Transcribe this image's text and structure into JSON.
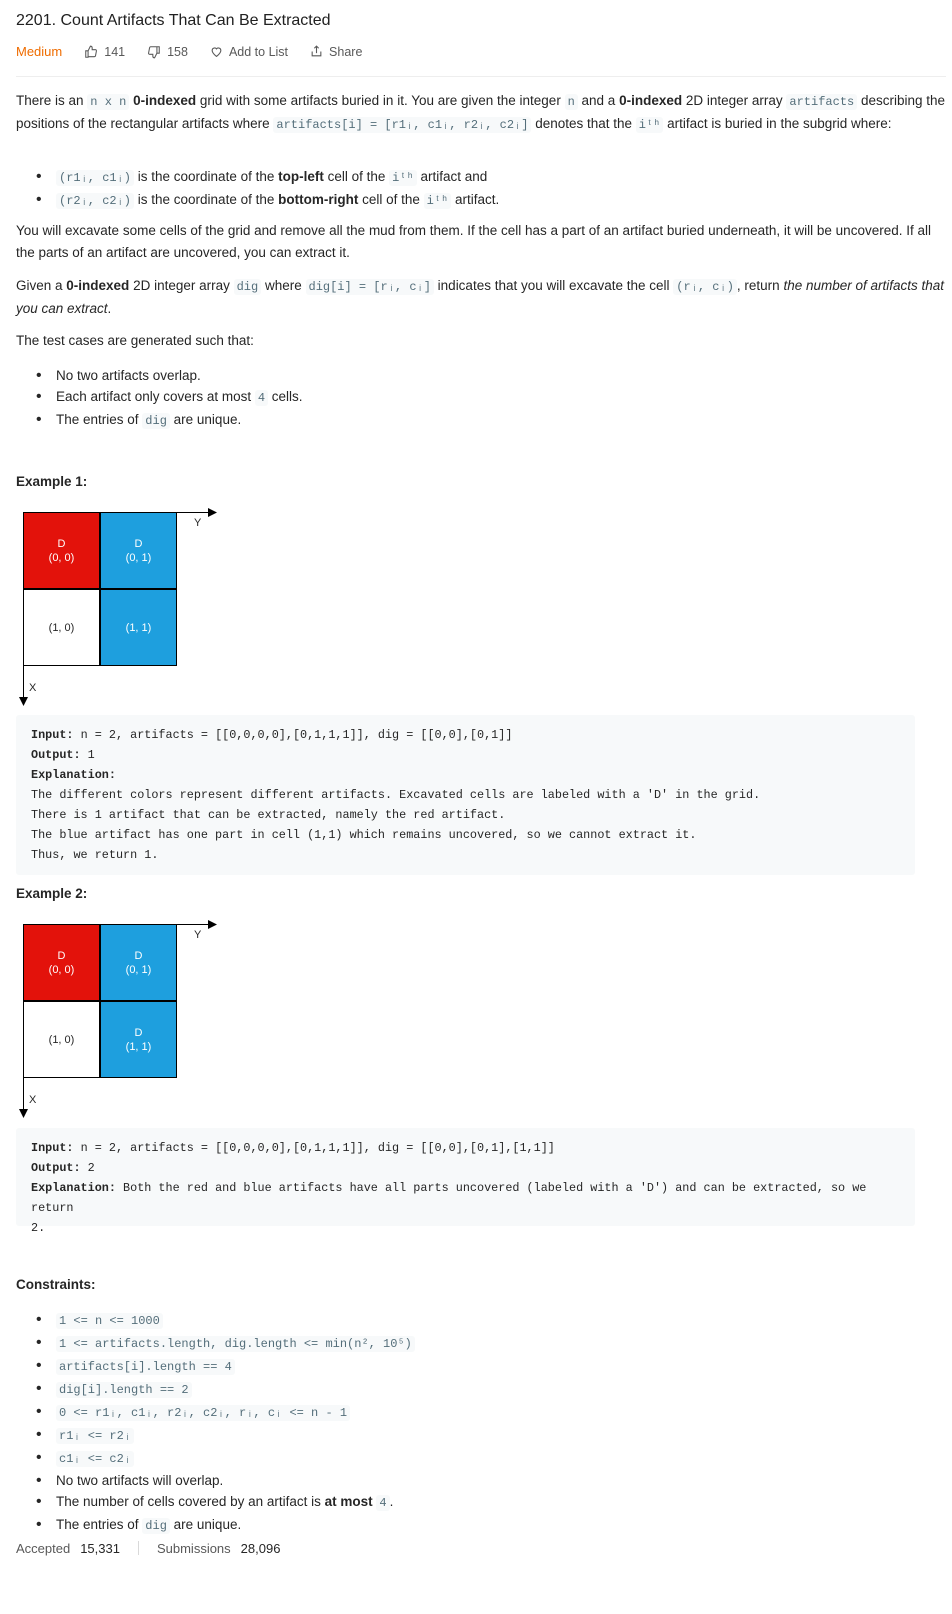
{
  "problem": {
    "title": "2201. Count Artifacts That Can Be Extracted",
    "difficulty": "Medium",
    "likes": "141",
    "dislikes": "158",
    "add_to_list": "Add to List",
    "share": "Share"
  },
  "description": {
    "p1_a": "There is an ",
    "p1_code_nxn": "n x n",
    "p1_b": " ",
    "p1_bold_0idx": "0-indexed",
    "p1_c": " grid with some artifacts buried in it. You are given the integer ",
    "p1_code_n": "n",
    "p1_d": " and a ",
    "p1_bold_0idx2": "0-indexed",
    "p1_e": " 2D integer array ",
    "p1_code_artifacts": "artifacts",
    "p1_f": " describing the positions of the rectangular artifacts where ",
    "p1_code_art_i": "artifacts[i] = [r1ᵢ, c1ᵢ, r2ᵢ, c2ᵢ]",
    "p1_g": " denotes that the ",
    "p1_code_ith": "iᵗʰ",
    "p1_h": " artifact is buried in the subgrid where:",
    "bullet1_code": "(r1ᵢ, c1ᵢ)",
    "bullet1_a": " is the coordinate of the ",
    "bullet1_bold": "top-left",
    "bullet1_b": " cell of the ",
    "bullet1_code2": "iᵗʰ",
    "bullet1_c": " artifact and",
    "bullet2_code": "(r2ᵢ, c2ᵢ)",
    "bullet2_a": " is the coordinate of the ",
    "bullet2_bold": "bottom-right",
    "bullet2_b": " cell of the ",
    "bullet2_code2": "iᵗʰ",
    "bullet2_c": " artifact.",
    "p2": "You will excavate some cells of the grid and remove all the mud from them. If the cell has a part of an artifact buried underneath, it will be uncovered. If all the parts of an artifact are uncovered, you can extract it.",
    "p3_a": "Given a ",
    "p3_bold": "0-indexed",
    "p3_b": " 2D integer array ",
    "p3_code_dig": "dig",
    "p3_c": " where ",
    "p3_code_digi": "dig[i] = [rᵢ, cᵢ]",
    "p3_d": " indicates that you will excavate the cell ",
    "p3_code_cell": "(rᵢ, cᵢ)",
    "p3_e": ", return ",
    "p3_ital": "the number of artifacts that you can extract",
    "p3_f": ".",
    "p4": "The test cases are generated such that:",
    "tc1": "No two artifacts overlap.",
    "tc2_a": "Each artifact only covers at most ",
    "tc2_code": "4",
    "tc2_b": " cells.",
    "tc3_a": "The entries of ",
    "tc3_code": "dig",
    "tc3_b": " are unique."
  },
  "examples": [
    {
      "heading": "Example 1:",
      "cells": [
        {
          "d": "D",
          "coord": "(0, 0)",
          "color": "red"
        },
        {
          "d": "D",
          "coord": "(0, 1)",
          "color": "blue"
        },
        {
          "d": "",
          "coord": "(1, 0)",
          "color": "white"
        },
        {
          "d": "",
          "coord": "(1, 1)",
          "color": "blue"
        }
      ],
      "axis_y": "Y",
      "axis_x": "X",
      "input_label": "Input:",
      "input": " n = 2, artifacts = [[0,0,0,0],[0,1,1,1]], dig = [[0,0],[0,1]]",
      "output_label": "Output:",
      "output": " 1",
      "explanation_label": "Explanation:",
      "explanation_lines": [
        "The different colors represent different artifacts. Excavated cells are labeled with a 'D' in the grid.",
        "There is 1 artifact that can be extracted, namely the red artifact.",
        "The blue artifact has one part in cell (1,1) which remains uncovered, so we cannot extract it.",
        "Thus, we return 1."
      ]
    },
    {
      "heading": "Example 2:",
      "cells": [
        {
          "d": "D",
          "coord": "(0, 0)",
          "color": "red"
        },
        {
          "d": "D",
          "coord": "(0, 1)",
          "color": "blue"
        },
        {
          "d": "",
          "coord": "(1, 0)",
          "color": "white"
        },
        {
          "d": "D",
          "coord": "(1, 1)",
          "color": "blue"
        }
      ],
      "axis_y": "Y",
      "axis_x": "X",
      "input_label": "Input:",
      "input": " n = 2, artifacts = [[0,0,0,0],[0,1,1,1]], dig = [[0,0],[0,1],[1,1]]",
      "output_label": "Output:",
      "output": " 2",
      "explanation_label": "Explanation:",
      "explanation_lines": [
        " Both the red and blue artifacts have all parts uncovered (labeled with a 'D') and can be extracted, so we return",
        "2."
      ]
    }
  ],
  "constraints": {
    "heading": "Constraints:",
    "c1": "1 <= n <= 1000",
    "c2": "1 <= artifacts.length, dig.length <= min(n², 10⁵)",
    "c3": "artifacts[i].length == 4",
    "c4": "dig[i].length == 2",
    "c5": "0 <= r1ᵢ, c1ᵢ, r2ᵢ, c2ᵢ, rᵢ, cᵢ <= n - 1",
    "c6": "r1ᵢ <= r2ᵢ",
    "c7": "c1ᵢ <= c2ᵢ",
    "c8": "No two artifacts will overlap.",
    "c9_a": "The number of cells covered by an artifact is ",
    "c9_bold": "at most",
    "c9_space": " ",
    "c9_code": "4",
    "c9_b": ".",
    "c10_a": "The entries of ",
    "c10_code": "dig",
    "c10_b": " are unique."
  },
  "stats": {
    "accepted_label": "Accepted",
    "accepted_value": "15,331",
    "submissions_label": "Submissions",
    "submissions_value": "28,096"
  },
  "colors": {
    "red": "#e3120b",
    "blue": "#1e9fde",
    "difficulty": "#ef6c00"
  },
  "icons": [
    "thumbs-up-icon",
    "thumbs-down-icon",
    "heart-icon",
    "share-icon"
  ]
}
